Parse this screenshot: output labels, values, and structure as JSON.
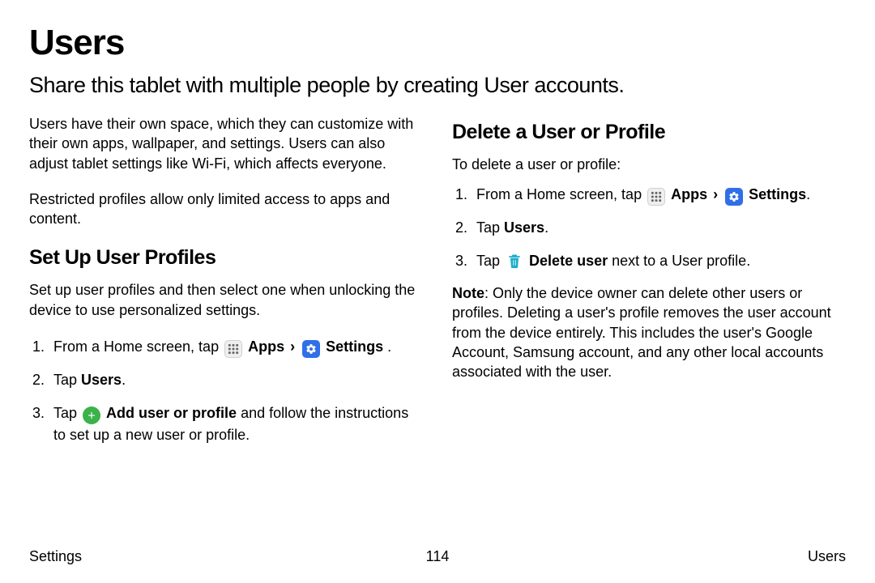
{
  "title": "Users",
  "subtitle": "Share this tablet with multiple people by creating User accounts.",
  "intro1": "Users have their own space, which they can customize with their own apps, wallpaper, and settings. Users can also adjust tablet settings like Wi-Fi, which affects everyone.",
  "intro2": "Restricted profiles allow only limited access to apps and content.",
  "setup": {
    "heading": "Set Up User Profiles",
    "intro": "Set up user profiles and then select one when unlocking the device to use personalized settings.",
    "step1_pre": "From a Home screen, tap ",
    "apps_label": "Apps",
    "settings_label": "Settings",
    "step1_post": " .",
    "step2_pre": "Tap ",
    "step2_bold": "Users",
    "step2_post": ".",
    "step3_pre": "Tap ",
    "step3_bold": "Add user or profile",
    "step3_post": "  and follow the instructions to set up a new user or profile."
  },
  "del": {
    "heading": "Delete a User or Profile",
    "intro": "To delete a user or profile:",
    "step1_pre": "From a Home screen, tap ",
    "apps_label": "Apps",
    "settings_label": "Settings",
    "step1_post": ".",
    "step2_pre": "Tap ",
    "step2_bold": "Users",
    "step2_post": ".",
    "step3_pre": "Tap ",
    "step3_bold": "Delete user",
    "step3_post": " next to a User profile.",
    "note_label": "Note",
    "note_body": ": Only the device owner can delete other users or profiles. Deleting a user's profile removes the user account from the device entirely. This includes the user's Google Account, Samsung account, and any other local accounts associated with the user."
  },
  "footer": {
    "left": "Settings",
    "center": "114",
    "right": "Users"
  }
}
